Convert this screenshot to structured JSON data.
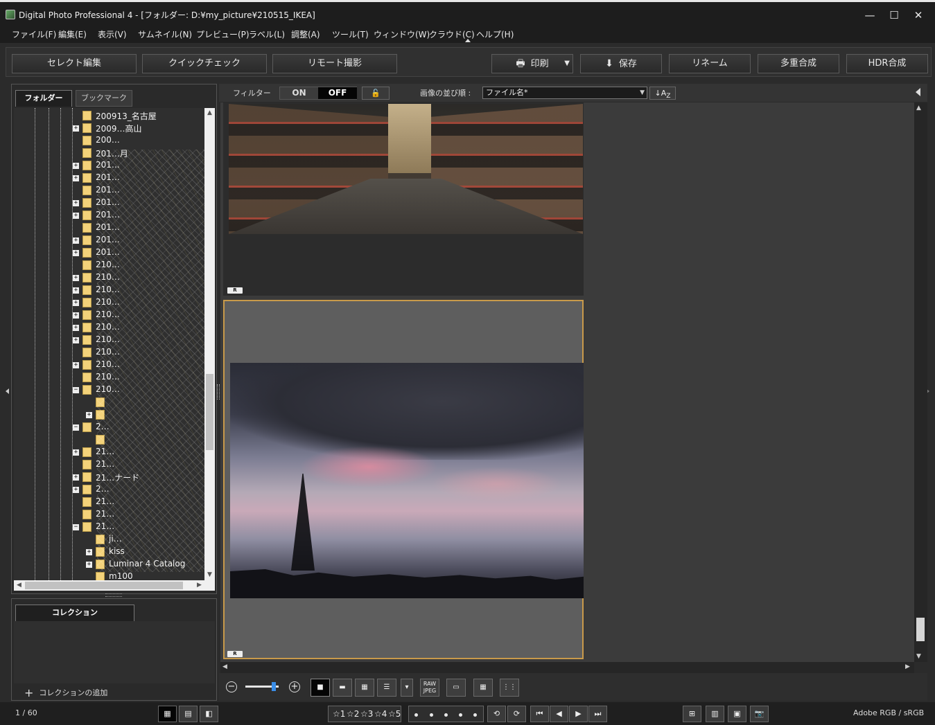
{
  "window": {
    "title": "Digital Photo Professional 4 - [フォルダー: D:¥my_picture¥210515_IKEA]",
    "minimize": "—",
    "maximize": "☐",
    "close": "✕"
  },
  "menu": [
    "ファイル(F)",
    "編集(E)",
    "表示(V)",
    "サムネイル(N)",
    "プレビュー(P)",
    "ラベル(L)",
    "調整(A)",
    "ツール(T)",
    "ウィンドウ(W)",
    "クラウド(C)",
    "ヘルプ(H)"
  ],
  "toolbar": {
    "select_edit": "セレクト編集",
    "quick_check": "クイックチェック",
    "remote_shoot": "リモート撮影",
    "print": "印刷",
    "save": "保存",
    "rename": "リネーム",
    "multi_exposure": "多重合成",
    "hdr": "HDR合成"
  },
  "left_panel": {
    "tab_folder": "フォルダー",
    "tab_bookmark": "ブックマーク",
    "tree": [
      {
        "label": "200913_名古屋",
        "expander": "",
        "indent": 1
      },
      {
        "label": "2009…高山",
        "expander": "+",
        "indent": 1
      },
      {
        "label": "200…",
        "expander": "",
        "indent": 1
      },
      {
        "label": "201…月",
        "expander": "",
        "indent": 1
      },
      {
        "label": "201…",
        "expander": "+",
        "indent": 1
      },
      {
        "label": "201…",
        "expander": "+",
        "indent": 1
      },
      {
        "label": "201…",
        "expander": "",
        "indent": 1
      },
      {
        "label": "201…",
        "expander": "+",
        "indent": 1
      },
      {
        "label": "201…",
        "expander": "+",
        "indent": 1
      },
      {
        "label": "201…",
        "expander": "",
        "indent": 1
      },
      {
        "label": "201…",
        "expander": "+",
        "indent": 1
      },
      {
        "label": "201…",
        "expander": "+",
        "indent": 1
      },
      {
        "label": "210…",
        "expander": "",
        "indent": 1
      },
      {
        "label": "210…",
        "expander": "+",
        "indent": 1
      },
      {
        "label": "210…",
        "expander": "+",
        "indent": 1
      },
      {
        "label": "210…",
        "expander": "+",
        "indent": 1
      },
      {
        "label": "210…",
        "expander": "+",
        "indent": 1
      },
      {
        "label": "210…",
        "expander": "+",
        "indent": 1
      },
      {
        "label": "210…",
        "expander": "+",
        "indent": 1
      },
      {
        "label": "210…",
        "expander": "",
        "indent": 1
      },
      {
        "label": "210…",
        "expander": "+",
        "indent": 1
      },
      {
        "label": "210…",
        "expander": "",
        "indent": 1
      },
      {
        "label": "210…",
        "expander": "−",
        "indent": 1
      },
      {
        "label": "",
        "expander": "",
        "indent": 2
      },
      {
        "label": "",
        "expander": "+",
        "indent": 2
      },
      {
        "label": "2…",
        "expander": "−",
        "indent": 1
      },
      {
        "label": "",
        "expander": "",
        "indent": 2
      },
      {
        "label": "21…",
        "expander": "+",
        "indent": 1
      },
      {
        "label": "21…",
        "expander": "",
        "indent": 1
      },
      {
        "label": "21…ナード",
        "expander": "+",
        "indent": 1
      },
      {
        "label": "2…",
        "expander": "+",
        "indent": 1
      },
      {
        "label": "21…",
        "expander": "",
        "indent": 1
      },
      {
        "label": "21…",
        "expander": "",
        "indent": 1
      },
      {
        "label": "21…",
        "expander": "−",
        "indent": 1
      },
      {
        "label": "ji…",
        "expander": "",
        "indent": 2
      },
      {
        "label": "kiss",
        "expander": "+",
        "indent": 2
      },
      {
        "label": "Luminar 4 Catalog",
        "expander": "+",
        "indent": 2
      },
      {
        "label": "m100",
        "expander": "",
        "indent": 2
      }
    ]
  },
  "collection": {
    "tab": "コレクション",
    "add": "コレクションの追加"
  },
  "filterbar": {
    "filter_label": "フィルター",
    "on": "ON",
    "off": "OFF",
    "lock_icon": "🔓",
    "sort_label": "画像の並び順 :",
    "sort_value": "ファイル名*",
    "az": "↓A",
    "az_sub": "Z"
  },
  "thumbnails": [
    {
      "badge": "R",
      "selected": false
    },
    {
      "badge": "R",
      "selected": true
    }
  ],
  "viewbar": {
    "zoom_out": "−",
    "zoom_in": "+",
    "zoom_level": 0.9,
    "raw_jpeg": "RAW\nJPEG"
  },
  "status": {
    "count": "1 / 60",
    "profile": "Adobe RGB / sRGB",
    "ratings": [
      "1",
      "2",
      "3",
      "4",
      "5"
    ]
  },
  "colors": {
    "selection_border": "#c99a4a",
    "slider_knob": "#3a8ee8",
    "folder": "#f3d27a"
  }
}
